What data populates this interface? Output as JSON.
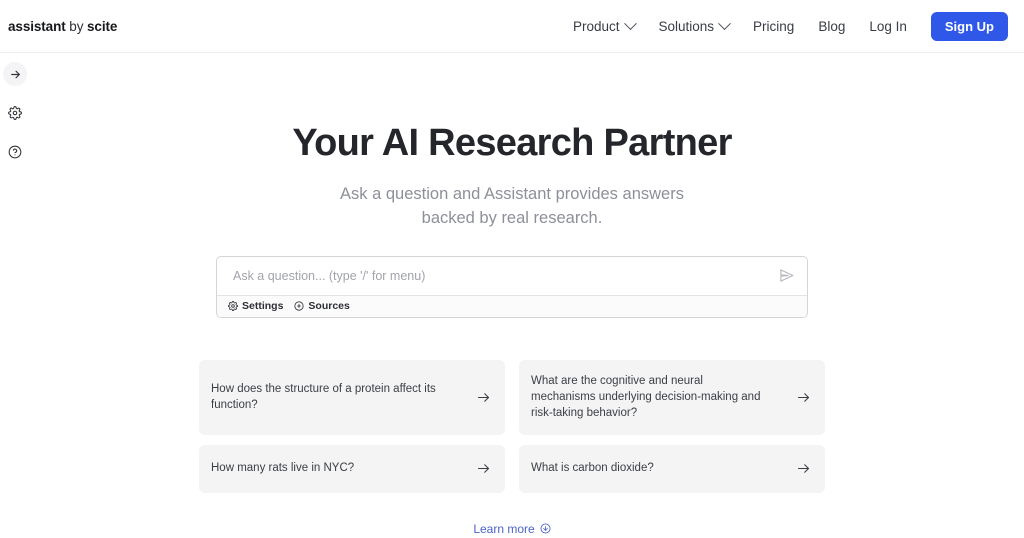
{
  "header": {
    "brand": {
      "product": "assistant",
      "connector": " by ",
      "company": "scite"
    },
    "nav": [
      {
        "label": "Product",
        "has_chevron": true,
        "icon": "chevron-down-icon"
      },
      {
        "label": "Solutions",
        "has_chevron": true,
        "icon": "chevron-down-icon"
      },
      {
        "label": "Pricing",
        "has_chevron": false
      },
      {
        "label": "Blog",
        "has_chevron": false
      },
      {
        "label": "Log In",
        "has_chevron": false
      }
    ],
    "signup_label": "Sign Up",
    "signup_color": "#2f57e8"
  },
  "rail": {
    "items": [
      {
        "icon": "arrow-right-icon",
        "name": "expand-sidebar-button"
      },
      {
        "icon": "gear-icon",
        "name": "settings-button"
      },
      {
        "icon": "help-circle-icon",
        "name": "help-button"
      }
    ]
  },
  "hero": {
    "title": "Your AI Research Partner",
    "subtitle_line1": "Ask a question and Assistant provides answers",
    "subtitle_line2": "backed by real research."
  },
  "composer": {
    "placeholder": "Ask a question... (type '/' for menu)",
    "value": "",
    "send_icon": "send-icon",
    "toolbar": [
      {
        "label": "Settings",
        "icon": "gear-icon"
      },
      {
        "label": "Sources",
        "icon": "plus-circle-icon"
      }
    ]
  },
  "suggestions": [
    {
      "text": "How does the structure of a protein affect its function?",
      "icon": "arrow-right-icon"
    },
    {
      "text": "What are the cognitive and neural mechanisms underlying decision-making and risk-taking behavior?",
      "icon": "arrow-right-icon"
    },
    {
      "text": "How many rats live in NYC?",
      "icon": "arrow-right-icon"
    },
    {
      "text": "What is carbon dioxide?",
      "icon": "arrow-right-icon"
    }
  ],
  "footer": {
    "learn_more_label": "Learn more",
    "learn_more_icon": "arrow-down-circle-icon",
    "link_color": "#4a63c8"
  }
}
